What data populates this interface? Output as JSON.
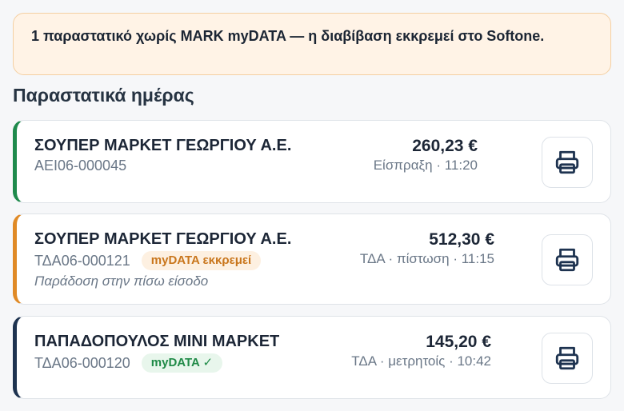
{
  "banner": {
    "text": "1 παραστατικό χωρίς MARK myDATA — η διαβίβαση εκκρεμεί στο Softone."
  },
  "section": {
    "title": "Παραστατικά ημέρας"
  },
  "colors": {
    "green_accent": "#1e8a4c",
    "orange_accent": "#e08a26",
    "navy_accent": "#1e3350"
  },
  "documents": [
    {
      "customer": "ΣΟΥΠΕΡ ΜΑΡΚΕΤ ΓΕΩΡΓΙΟΥ Α.Ε.",
      "code": "ΑΕΙ06-000045",
      "badge": "",
      "amount": "260,23 €",
      "meta": "Είσπραξη · 11:20",
      "note": "",
      "print_icon": "printer-icon"
    },
    {
      "customer": "ΣΟΥΠΕΡ ΜΑΡΚΕΤ ΓΕΩΡΓΙΟΥ Α.Ε.",
      "code": "ΤΔΑ06-000121",
      "badge": "myDATA εκκρεμεί",
      "amount": "512,30 €",
      "meta": "ΤΔΑ · πίστωση · 11:15",
      "note": "Παράδοση στην πίσω είσοδο",
      "print_icon": "printer-icon"
    },
    {
      "customer": "ΠΑΠΑΔΟΠΟΥΛΟΣ ΜΙΝΙ ΜΑΡΚΕΤ",
      "code": "ΤΔΑ06-000120",
      "badge": "myDATA ✓",
      "amount": "145,20 €",
      "meta": "ΤΔΑ · μετρητοίς · 10:42",
      "note": "",
      "print_icon": "printer-icon"
    }
  ]
}
